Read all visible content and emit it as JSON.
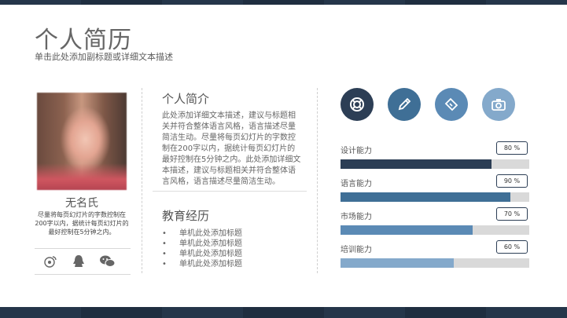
{
  "header": {
    "title": "个人简历",
    "subtitle": "单击此处添加副标题或详细文本描述"
  },
  "profile": {
    "name": "无名氏",
    "description": "尽量将每页幻灯片的字数控制在200字以内，据统计每页幻灯片的最好控制在5分钟之内。",
    "social_icons": [
      "weibo-icon",
      "qq-icon",
      "wechat-icon"
    ]
  },
  "intro": {
    "heading": "个人简介",
    "text": "此处添加详细文本描述，建议与标题相关并符合整体语言风格，语言描述尽量简洁生动。尽量将每页幻灯片的字数控制在200字以内，据统计每页幻灯片的最好控制在5分钟之内。此处添加详细文本描述，建议与标题相关并符合整体语言风格，语言描述尽量简洁生动。"
  },
  "education": {
    "heading": "教育经历",
    "items": [
      "单机此处添加标题",
      "单机此处添加标题",
      "单机此处添加标题",
      "单机此处添加标题"
    ]
  },
  "icons": [
    {
      "name": "lifebuoy-icon",
      "color": "#2c3e55"
    },
    {
      "name": "pencil-icon",
      "color": "#3f6f96"
    },
    {
      "name": "ticket-icon",
      "color": "#5b8ab5"
    },
    {
      "name": "camera-icon",
      "color": "#84a9cb"
    }
  ],
  "skills": [
    {
      "label": "设计能力",
      "value_label": "80 %",
      "value": 0.8,
      "color": "#2c3e55"
    },
    {
      "label": "语言能力",
      "value_label": "90 %",
      "value": 0.9,
      "color": "#3f6f96"
    },
    {
      "label": "市场能力",
      "value_label": "70 %",
      "value": 0.7,
      "color": "#5b8ab5"
    },
    {
      "label": "培训能力",
      "value_label": "60 %",
      "value": 0.6,
      "color": "#84a9cb"
    }
  ]
}
